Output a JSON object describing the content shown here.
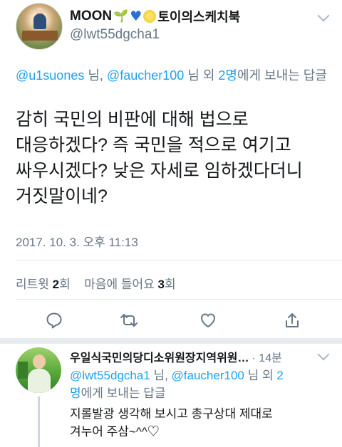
{
  "tweet": {
    "display_name": "MOON",
    "name_suffix": "토이의스케치북",
    "handle": "@lwt55dgcha1",
    "reply_to": {
      "user1": "@u1suones",
      "sep1": " 님, ",
      "user2": "@faucher100",
      "mid": " 님 외 ",
      "others": "2명",
      "tail": "에게 보내는 답글"
    },
    "text_lines": [
      "감히 국민의 비판에 대해 법으로",
      "대응하겠다? 즉 국민을 적으로 여기고",
      "싸우시겠다? 낮은 자세로 임하겠다더니",
      "거짓말이네?"
    ],
    "timestamp": "2017. 10. 3. 오후 11:13",
    "stats": {
      "retweet_label": "리트윗 ",
      "retweet_count": "2",
      "retweet_unit": "회",
      "like_label": "마음에 들어요 ",
      "like_count": "3",
      "like_unit": "회"
    },
    "icons": [
      "reply-icon",
      "retweet-icon",
      "like-icon",
      "share-icon"
    ],
    "colors": {
      "link": "#1da1f2",
      "muted": "#657786",
      "text": "#14171a"
    }
  },
  "reply": {
    "display_name": "우일식국민의당디소위원장지역위원…",
    "time": "· 14분",
    "reply_to": {
      "user1": "@lwt55dgcha1",
      "sep1": " 님, ",
      "user2": "@faucher100",
      "mid": " 님 외 ",
      "others": "2",
      "line2_others": "명",
      "tail": "에게 보내는 답글"
    },
    "text_lines": [
      "지롤발광  생각해 보시고 총구상대 제대로",
      "겨누어 주삼~^^♡"
    ]
  }
}
